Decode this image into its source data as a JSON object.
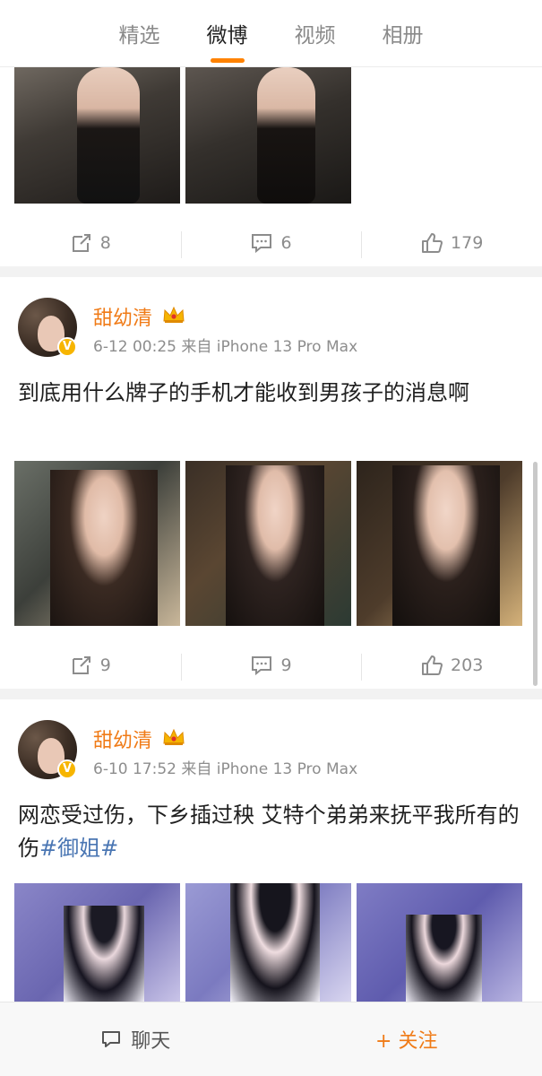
{
  "tabs": [
    {
      "label": "精选"
    },
    {
      "label": "微博"
    },
    {
      "label": "视频"
    },
    {
      "label": "相册"
    }
  ],
  "active_tab_color": "#ff8200",
  "posts": [
    {
      "actions": {
        "repost": "8",
        "comment": "6",
        "like": "179"
      }
    },
    {
      "username": "甜幼清",
      "meta": "6-12 00:25 来自 iPhone 13 Pro Max",
      "text": "到底用什么牌子的手机才能收到男孩子的消息啊",
      "actions": {
        "repost": "9",
        "comment": "9",
        "like": "203"
      }
    },
    {
      "username": "甜幼清",
      "meta": "6-10 17:52 来自 iPhone 13 Pro Max",
      "text": "网恋受过伤，下乡插过秧 艾特个弟弟来抚平我所有的伤",
      "hashtag": "#御姐#"
    }
  ],
  "bottom_bar": {
    "chat": "聊天",
    "follow": "+ 关注"
  },
  "colors": {
    "username": "#f07b17",
    "hashtag": "#4a76b3",
    "verified_badge": "#f7b500"
  },
  "icons": [
    "repost-icon",
    "comment-icon",
    "like-icon",
    "chat-icon",
    "crown-icon",
    "verified-icon"
  ]
}
